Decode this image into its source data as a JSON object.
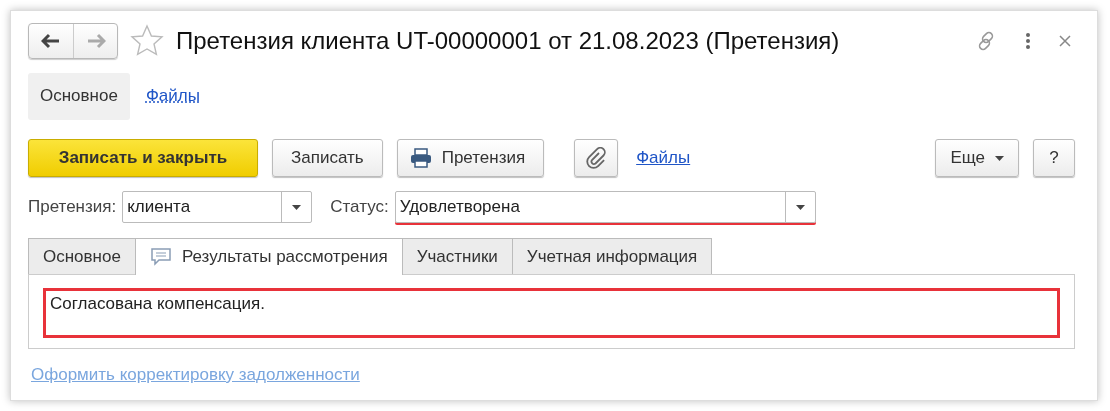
{
  "window": {
    "title": "Претензия клиента UT-00000001 от 21.08.2023 (Претензия)",
    "favorite": false
  },
  "nav_tabs": [
    {
      "label": "Основное",
      "selected": true
    },
    {
      "label": "Файлы",
      "selected": false
    }
  ],
  "toolbar": {
    "buttons": [
      {
        "kind": "primary",
        "label": "Записать и закрыть"
      },
      {
        "kind": "plain",
        "label": "Записать"
      },
      {
        "kind": "print",
        "label": "Претензия"
      },
      {
        "kind": "attach"
      },
      {
        "kind": "link",
        "label": "Файлы"
      }
    ],
    "right_buttons": [
      {
        "kind": "menu",
        "label": "Еще"
      },
      {
        "kind": "plain",
        "label": "?"
      }
    ]
  },
  "fields": [
    {
      "label": "Претензия:",
      "value": "клиента",
      "highlighted": false
    },
    {
      "label": "Статус:",
      "value": "Удовлетворена",
      "highlighted": true
    }
  ],
  "tabs": [
    {
      "label": "Основное",
      "selected": false,
      "kind": "plain"
    },
    {
      "label": "Результаты рассмотрения",
      "selected": true,
      "kind": "comment"
    },
    {
      "label": "Участники",
      "selected": false,
      "kind": "plain"
    },
    {
      "label": "Учетная информация",
      "selected": false,
      "kind": "plain"
    }
  ],
  "result": {
    "text": "Согласована компенсация.",
    "highlighted": true
  },
  "footer_link": "Оформить корректировку задолженности"
}
